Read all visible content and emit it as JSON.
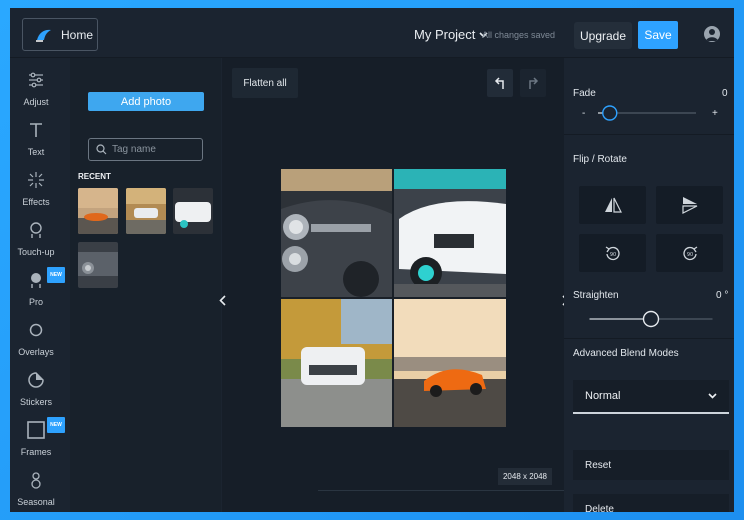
{
  "topbar": {
    "home_label": "Home",
    "project_name": "My Project",
    "save_status": "All changes saved",
    "upgrade_label": "Upgrade",
    "save_label": "Save"
  },
  "tools": [
    {
      "label": "Adjust",
      "icon": "sliders-icon",
      "badge": ""
    },
    {
      "label": "Text",
      "icon": "text-icon",
      "badge": ""
    },
    {
      "label": "Effects",
      "icon": "sparkle-icon",
      "badge": ""
    },
    {
      "label": "Touch-up",
      "icon": "face-icon",
      "badge": ""
    },
    {
      "label": "Pro",
      "icon": "pro-icon",
      "badge": "NEW"
    },
    {
      "label": "Overlays",
      "icon": "circle-icon",
      "badge": ""
    },
    {
      "label": "Stickers",
      "icon": "sticker-icon",
      "badge": ""
    },
    {
      "label": "Frames",
      "icon": "frame-icon",
      "badge": "NEW"
    },
    {
      "label": "Seasonal",
      "icon": "snowman-icon",
      "badge": ""
    }
  ],
  "photos": {
    "add_label": "Add photo",
    "search_placeholder": "Tag name",
    "recent_label": "RECENT"
  },
  "canvas": {
    "flatten_label": "Flatten all",
    "size_label": "2048 x 2048"
  },
  "right": {
    "fade_label": "Fade",
    "fade_value": "0",
    "fade_minus": "-",
    "fade_plus": "+",
    "fade_level": 0.12,
    "flip_label": "Flip / Rotate",
    "straighten_label": "Straighten",
    "straighten_value": "0 °",
    "straighten_level": 0.5,
    "blend_label": "Advanced Blend Modes",
    "blend_value": "Normal",
    "reset_label": "Reset",
    "delete_label": "Delete"
  },
  "colors": {
    "accent": "#2ea2ff",
    "background": "#1b2430"
  }
}
